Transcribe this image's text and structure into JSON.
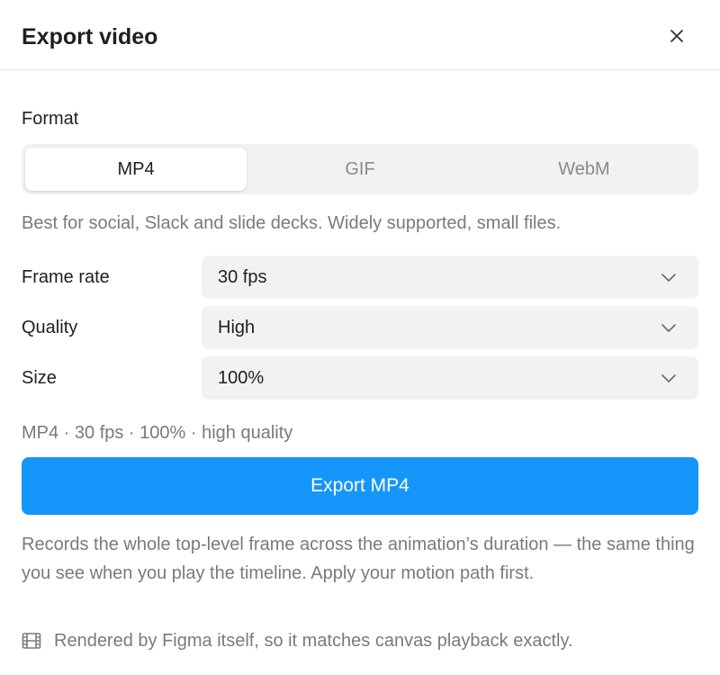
{
  "dialog": {
    "title": "Export video",
    "close_icon": "close-icon"
  },
  "format": {
    "label": "Format",
    "options": [
      {
        "label": "MP4",
        "selected": true
      },
      {
        "label": "GIF",
        "selected": false
      },
      {
        "label": "WebM",
        "selected": false
      }
    ],
    "description": "Best for social, Slack and slide decks. Widely supported, small files."
  },
  "settings": {
    "frame_rate": {
      "label": "Frame rate",
      "value": "30 fps"
    },
    "quality": {
      "label": "Quality",
      "value": "High"
    },
    "size": {
      "label": "Size",
      "value": "100%"
    }
  },
  "summary": "MP4 · 30 fps · 100% · high quality",
  "export_button": {
    "label": "Export MP4",
    "color": "#1496fa"
  },
  "note": "Records the whole top-level frame across the animation’s duration — the same thing you see when you play the timeline. Apply your motion path first.",
  "footnote": {
    "icon": "film-icon",
    "text": "Rendered by Figma itself, so it matches canvas playback exactly."
  }
}
